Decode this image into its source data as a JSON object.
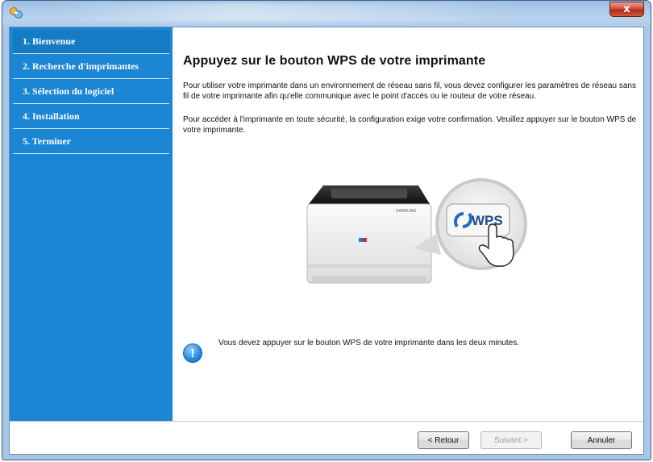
{
  "window": {
    "close_glyph": "x"
  },
  "sidebar": {
    "steps": [
      {
        "label": "1. Bienvenue"
      },
      {
        "label": "2. Recherche d'imprimantes"
      },
      {
        "label": "3. Sélection du logiciel"
      },
      {
        "label": "4. Installation"
      },
      {
        "label": "5. Terminer"
      }
    ]
  },
  "main": {
    "title": "Appuyez sur le bouton WPS  de votre imprimante",
    "paragraph1": "Pour utiliser votre imprimante dans un environnement de réseau sans fil, vous devez configurer les paramètres de réseau sans fil de votre imprimante afin qu'elle communique avec le point d'accès ou le routeur de votre réseau.",
    "paragraph2": "Pour accéder à l'imprimante en toute sécurité, la configuration exige votre confirmation.  Veuillez appuyer sur le bouton WPS  de votre imprimante.",
    "illustration": {
      "printer_brand": "SAMSUNG",
      "wps_label": "WPS"
    },
    "notice": "Vous devez appuyer sur le bouton WPS  de votre imprimante dans les deux minutes.",
    "notice_icon": "!"
  },
  "footer": {
    "back_label": "< Retour",
    "next_label": "Suivant >",
    "cancel_label": "Annuler"
  },
  "colors": {
    "sidebar": "#1a86d4",
    "accent": "#2b8fe0"
  }
}
